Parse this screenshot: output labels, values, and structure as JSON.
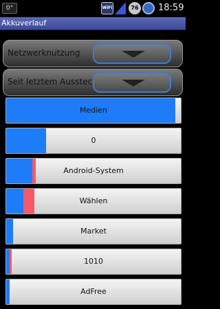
{
  "status_bar": {
    "notification": "0°",
    "wifi_label": "WiFi",
    "battery": "76",
    "time": "18:59"
  },
  "title": "Akkuverlauf",
  "dropdowns": [
    {
      "label": "Netzwerknutzung"
    },
    {
      "label": "Seit letztem Ausstecken"
    }
  ],
  "items": [
    {
      "label": "Medien",
      "usage_fraction": 0.97,
      "secondary_fraction": 0.0
    },
    {
      "label": "0",
      "usage_fraction": 0.23,
      "secondary_fraction": 0.0
    },
    {
      "label": "Android-System",
      "usage_fraction": 0.15,
      "secondary_fraction": 0.02
    },
    {
      "label": "Wählen",
      "usage_fraction": 0.1,
      "secondary_fraction": 0.06
    },
    {
      "label": "Market",
      "usage_fraction": 0.04,
      "secondary_fraction": 0.0
    },
    {
      "label": "1010",
      "usage_fraction": 0.02,
      "secondary_fraction": 0.01
    },
    {
      "label": "AdFree",
      "usage_fraction": 0.02,
      "secondary_fraction": 0.0
    }
  ],
  "colors": {
    "primary_bar": "#1e7cf8",
    "secondary_bar": "#f25a6a",
    "title_bar": "#4a58a4"
  }
}
